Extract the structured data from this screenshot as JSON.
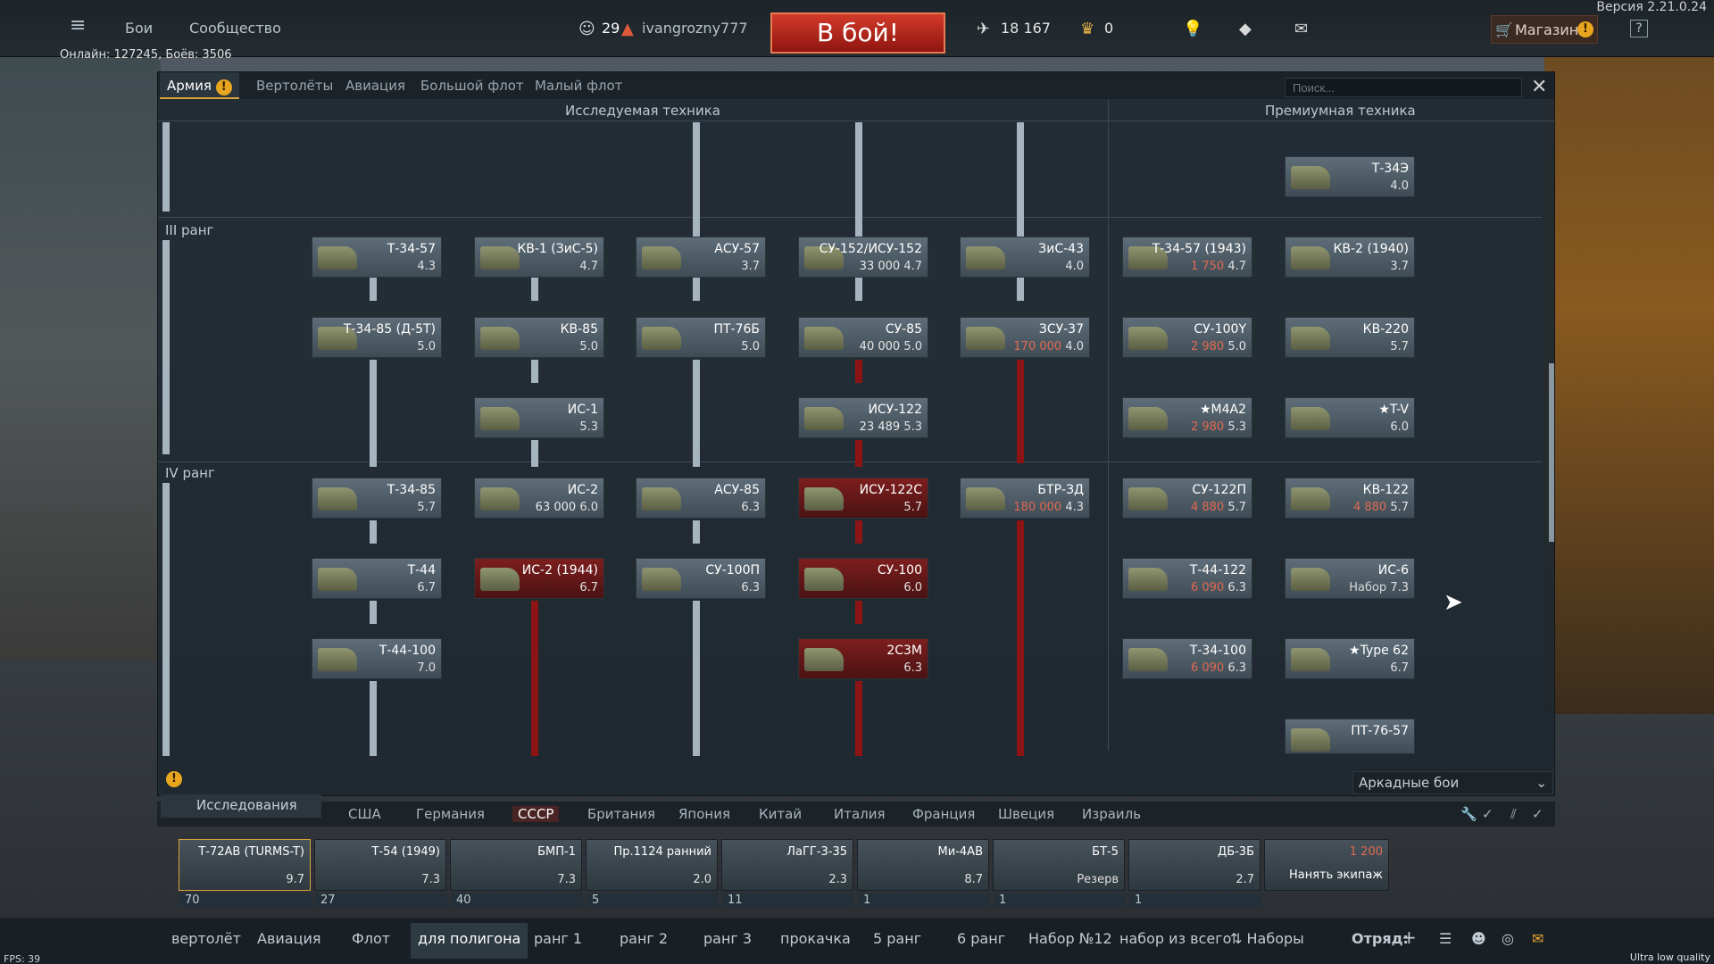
{
  "topbar": {
    "menu_label": "≡",
    "battles": "Бои",
    "community": "Сообщество",
    "level": "29",
    "nickname": "ivangrozny777",
    "battle_button": "В бой!",
    "silver": "18 167",
    "gold": "0",
    "shop": "Магазин",
    "help": "?",
    "version": "Версия 2.21.0.24",
    "online": "Онлайн: 127245, Боёв: 3506"
  },
  "window": {
    "tabs": [
      "Армия",
      "Вертолёты",
      "Авиация",
      "Большой флот",
      "Малый флот"
    ],
    "search_placeholder": "Поиск...",
    "researched_header": "Исследуемая техника",
    "premium_header": "Премиумная техника",
    "rank3": "III ранг",
    "rank4": "IV ранг",
    "close": "✕"
  },
  "nodes": [
    {
      "name": "Т-34-57",
      "cost": "",
      "br": "4.3"
    },
    {
      "name": "КВ-1 (ЗиС-5)",
      "cost": "",
      "br": "4.7"
    },
    {
      "name": "АСУ-57",
      "cost": "",
      "br": "3.7"
    },
    {
      "name": "СУ-152/ИСУ-152",
      "cost": "33 000",
      "br": "4.7"
    },
    {
      "name": "ЗиС-43",
      "cost": "",
      "br": "4.0"
    },
    {
      "name": "Т-34-85 (Д-5Т)",
      "cost": "",
      "br": "5.0"
    },
    {
      "name": "КВ-85",
      "cost": "",
      "br": "5.0"
    },
    {
      "name": "ПТ-76Б",
      "cost": "",
      "br": "5.0"
    },
    {
      "name": "СУ-85",
      "cost": "40 000",
      "br": "5.0"
    },
    {
      "name": "ЗСУ-37",
      "cost": "170 000",
      "br": "4.0"
    },
    {
      "name": "ИС-1",
      "cost": "",
      "br": "5.3"
    },
    {
      "name": "ИСУ-122",
      "cost": "23 489",
      "br": "5.3"
    },
    {
      "name": "Т-34-85",
      "cost": "",
      "br": "5.7"
    },
    {
      "name": "ИС-2",
      "cost": "63 000",
      "br": "6.0"
    },
    {
      "name": "АСУ-85",
      "cost": "",
      "br": "6.3"
    },
    {
      "name": "ИСУ-122С",
      "cost": "",
      "br": "5.7"
    },
    {
      "name": "БТР-ЗД",
      "cost": "180 000",
      "br": "4.3"
    },
    {
      "name": "Т-44",
      "cost": "",
      "br": "6.7"
    },
    {
      "name": "ИС-2 (1944)",
      "cost": "",
      "br": "6.7"
    },
    {
      "name": "СУ-100П",
      "cost": "",
      "br": "6.3"
    },
    {
      "name": "СУ-100",
      "cost": "",
      "br": "6.0"
    },
    {
      "name": "Т-44-100",
      "cost": "",
      "br": "7.0"
    },
    {
      "name": "2С3М",
      "cost": "",
      "br": "6.3"
    }
  ],
  "premium": [
    {
      "name": "Т-34Э",
      "cost": "",
      "br": "4.0"
    },
    {
      "name": "Т-34-57 (1943)",
      "cost": "1 750",
      "br": "4.7"
    },
    {
      "name": "КВ-2 (1940)",
      "cost": "",
      "br": "3.7"
    },
    {
      "name": "СУ-100Y",
      "cost": "2 980",
      "br": "5.0"
    },
    {
      "name": "КВ-220",
      "cost": "",
      "br": "5.7"
    },
    {
      "name": "★M4A2",
      "cost": "2 980",
      "br": "5.3"
    },
    {
      "name": "★T-V",
      "cost": "",
      "br": "6.0"
    },
    {
      "name": "СУ-122П",
      "cost": "4 880",
      "br": "5.7"
    },
    {
      "name": "КВ-122",
      "cost": "4 880",
      "br": "5.7"
    },
    {
      "name": "Т-44-122",
      "cost": "6 090",
      "br": "6.3"
    },
    {
      "name": "ИС-6",
      "cost": "Набор",
      "br": "7.3"
    },
    {
      "name": "Т-34-100",
      "cost": "6 090",
      "br": "6.3"
    },
    {
      "name": "★Type 62",
      "cost": "",
      "br": "6.7"
    },
    {
      "name": "ПТ-76-57",
      "cost": "",
      "br": ""
    }
  ],
  "research_label": "Исследования",
  "mode": "Аркадные бои",
  "flags": [
    "США",
    "Германия",
    "СССР",
    "Британия",
    "Япония",
    "Китай",
    "Италия",
    "Франция",
    "Швеция",
    "Израиль"
  ],
  "slots": [
    {
      "name": "Т-72АВ (TURMS-T)",
      "br": "9.7",
      "crew": "70"
    },
    {
      "name": "Т-54 (1949)",
      "br": "7.3",
      "crew": "27"
    },
    {
      "name": "БМП-1",
      "br": "7.3",
      "crew": "40"
    },
    {
      "name": "Пр.1124 ранний",
      "br": "2.0",
      "crew": "5"
    },
    {
      "name": "ЛаГГ-3-35",
      "br": "2.3",
      "crew": "11"
    },
    {
      "name": "Ми-4АВ",
      "br": "8.7",
      "crew": "1"
    },
    {
      "name": "БТ-5",
      "br": "Резерв",
      "crew": "1"
    },
    {
      "name": "ДБ-3Б",
      "br": "2.7",
      "crew": "1"
    },
    {
      "name": "Нанять экипаж",
      "br": "1 200",
      "crew": ""
    }
  ],
  "presets": [
    "вертолёт",
    "Авиация",
    "Флот",
    "для полигона",
    "ранг 1",
    "ранг 2",
    "ранг 3",
    "прокачка",
    "5 ранг",
    "6 ранг",
    "Набор №12",
    "набор из всего",
    "Наборы"
  ],
  "squad_label": "Отряд:",
  "fps": "FPS: 39",
  "quality": "Ultra low quality",
  "colors": {
    "accent": "#d9a43a",
    "battle": "#c9321f",
    "locked": "#8d1414"
  }
}
